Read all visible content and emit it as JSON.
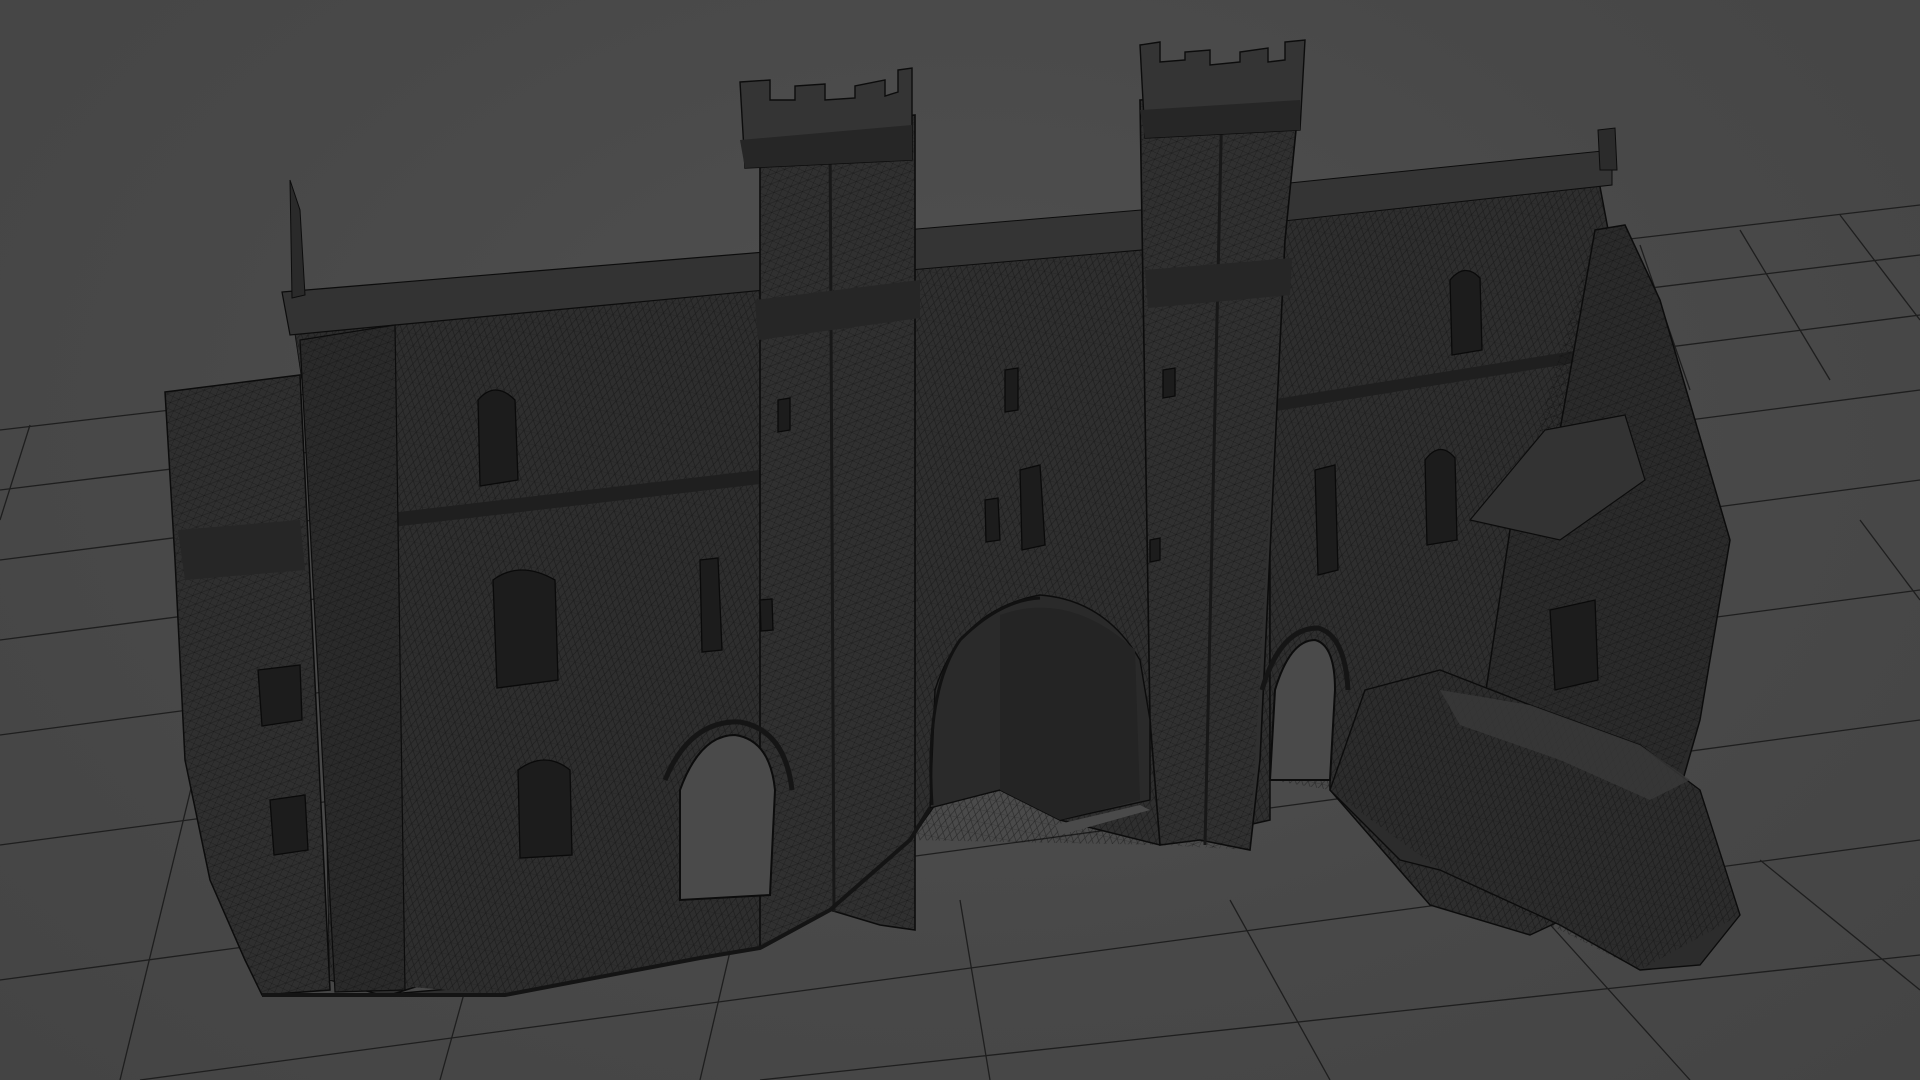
{
  "viewport": {
    "background": "#4a4a4a",
    "grid_color": "#1e1e1e",
    "mesh_fill": "#2e2e2e",
    "mesh_shadow": "#1b1b1b",
    "wire_color": "#0c0c0c"
  },
  "scene": {
    "object": "gatehouse-mesh",
    "display_mode": "wireframe-over-shaded",
    "features": [
      "left-tower-crenellations-icon",
      "right-tower-crenellations-icon",
      "main-archway-icon",
      "side-archway-icon",
      "right-archway-icon",
      "annex-roof-icon"
    ]
  }
}
